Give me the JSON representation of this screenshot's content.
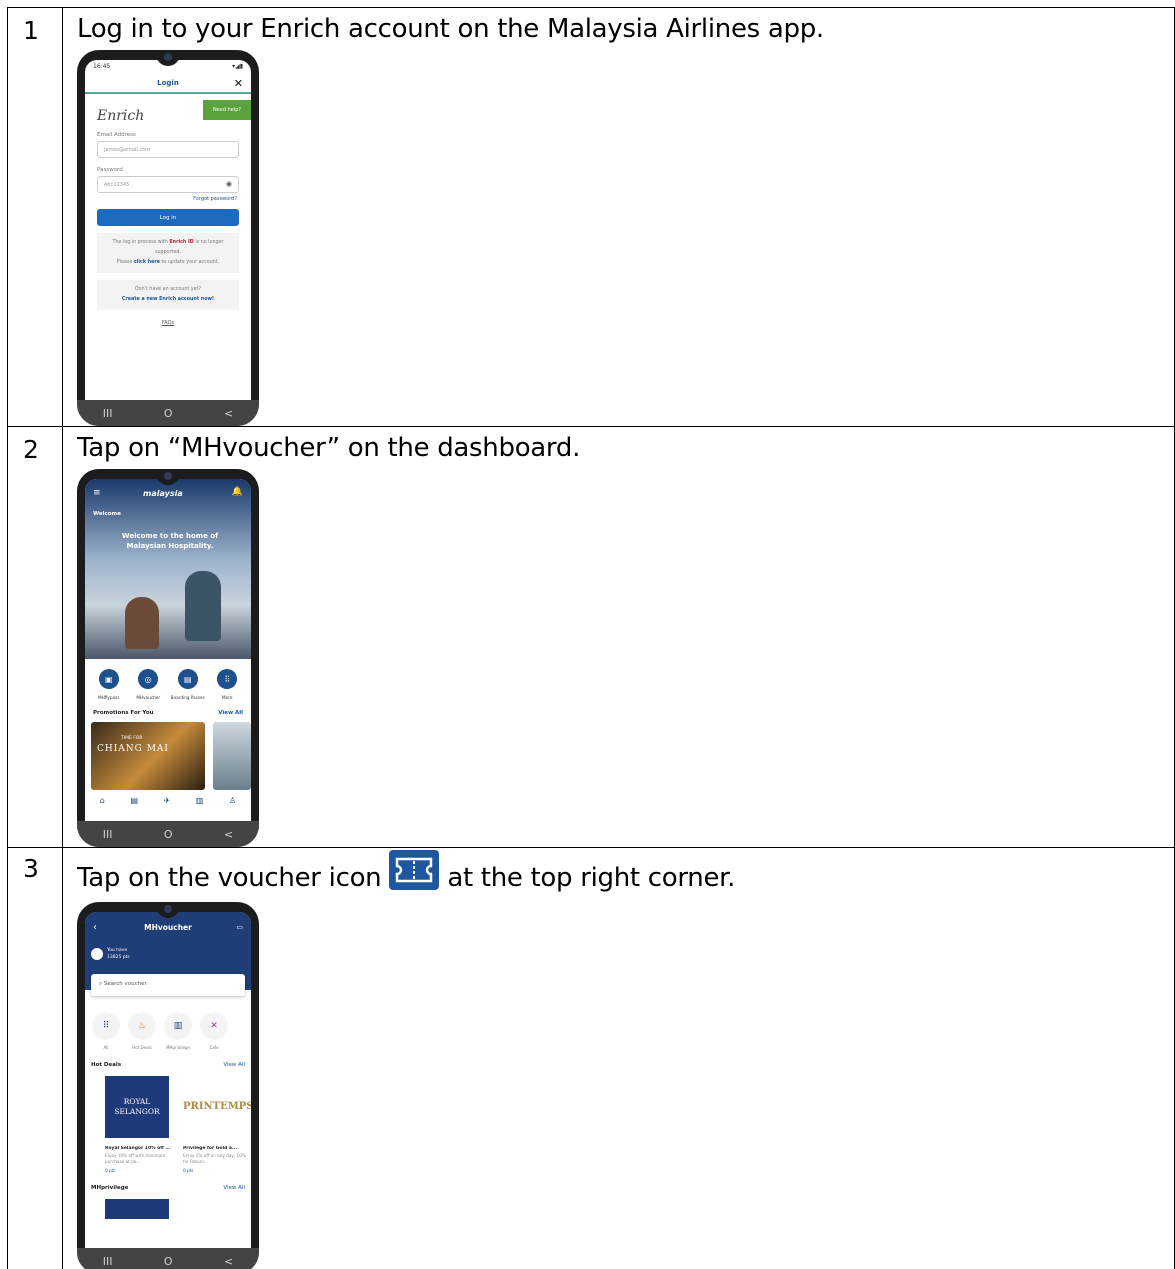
{
  "steps": [
    {
      "number": "1",
      "text": "Log in to your Enrich account on the Malaysia Airlines app."
    },
    {
      "number": "2",
      "text": "Tap on “MHvoucher” on the dashboard."
    },
    {
      "number": "3",
      "text_before": "Tap on the voucher icon",
      "text_after": "at the top right corner."
    }
  ],
  "phone1": {
    "time": "16:45",
    "header_title": "Login",
    "close": "✕",
    "help_button": "Need help?",
    "logo_text": "Enrich",
    "email_label": "Email Address",
    "email_placeholder": "james@email.com",
    "password_label": "Password",
    "password_value": "Abc12345",
    "forgot": "Forgot password?",
    "login_button": "Log in",
    "notice_part1": "The log in process with",
    "notice_enrich": "Enrich ID",
    "notice_part2": "is no longer supported.",
    "notice_part3": "Please",
    "notice_link": "click here",
    "notice_part4": "to update your account.",
    "signup_text": "Don't have an account yet?",
    "signup_link": "Create a new Enrich account now!",
    "faqs": "FAQs"
  },
  "phone2": {
    "brand": "malaysia",
    "welcome_tag": "Welcome",
    "welcome_message": "Welcome to the home of Malaysian Hospitality.",
    "quick_actions": [
      "MHflypass",
      "MHvoucher",
      "Boarding Passes",
      "More"
    ],
    "promotions_title": "Promotions For You",
    "view_all": "View All",
    "promo_card_title": "CHIANG MAI",
    "promo_card_sub": "TIME FOR"
  },
  "phone3": {
    "title": "MHvoucher",
    "points_label": "You have",
    "points_value": "13825 pts",
    "search_placeholder": "Search voucher",
    "categories": [
      "All",
      "Hot Deals",
      "MHprivilege",
      "Cafe"
    ],
    "hot_deals_title": "Hot Deals",
    "view_all": "View All",
    "deal1_img": "ROYAL SELANGOR",
    "deal1_title": "Royal Selangor 10% off ...",
    "deal1_desc": "Enjoy 10% off with minimum purchase at pa...",
    "deal1_pts": "0 pts",
    "deal2_img": "PRINTEMPS",
    "deal2_title": "Privilege for Gold a...",
    "deal2_desc": "Enjoy 5% off on any day, 10% for Return...",
    "deal2_pts": "0 pts",
    "privilege_title": "MHprivilege"
  },
  "navbar": [
    "III",
    "O",
    "<"
  ],
  "colors": {
    "brand_blue": "#1e56a0",
    "voucher_header": "#1f3d77",
    "help_green": "#5aa33a"
  }
}
